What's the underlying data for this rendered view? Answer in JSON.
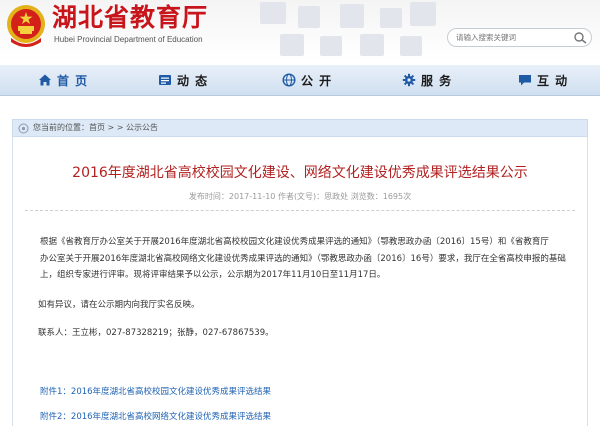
{
  "header": {
    "site_title": "湖北省教育厅",
    "site_subtitle": "Hubei Provincial Department of Education",
    "search_placeholder": "请输入搜索关键词"
  },
  "nav": {
    "items": [
      {
        "label": "首 页",
        "icon": "home-icon"
      },
      {
        "label": "动 态",
        "icon": "news-icon"
      },
      {
        "label": "公 开",
        "icon": "globe-icon"
      },
      {
        "label": "服 务",
        "icon": "gear-icon"
      },
      {
        "label": "互 动",
        "icon": "chat-icon"
      }
    ]
  },
  "breadcrumb": {
    "text": "您当前的位置：首页 > > 公示公告"
  },
  "article": {
    "title": "2016年度湖北省高校校园文化建设、网络文化建设优秀成果评选结果公示",
    "meta": "发布时间：2017-11-10 作者(文号)：思政处 浏览数：1695次",
    "para1_line1": "根据《省教育厅办公室关于开展2016年度湖北省高校校园文化建设优秀成果评选的通知》（鄂教思政办函〔2016〕15号）和《省教育厅",
    "para1_line2": "办公室关于开展2016年度湖北省高校网络文化建设优秀成果评选的通知》（鄂教思政办函〔2016〕16号）要求，我厅在全省高校申报的基础",
    "para1_line3": "上，组织专家进行评审。现将评审结果予以公示，公示期为2017年11月10日至11月17日。",
    "para2": "如有异议，请在公示期内向我厅实名反映。",
    "para3": "联系人：王立彬，027-87328219；张静，027-67867539。",
    "attachments": [
      "附件1：2016年度湖北省高校校园文化建设优秀成果评选结果",
      "附件2：2016年度湖北省高校网络文化建设优秀成果评选结果"
    ]
  },
  "colors": {
    "title_red": "#c8151b",
    "article_title": "#b22121",
    "link_blue": "#1f63b4",
    "nav_active": "#1f5aa4"
  }
}
